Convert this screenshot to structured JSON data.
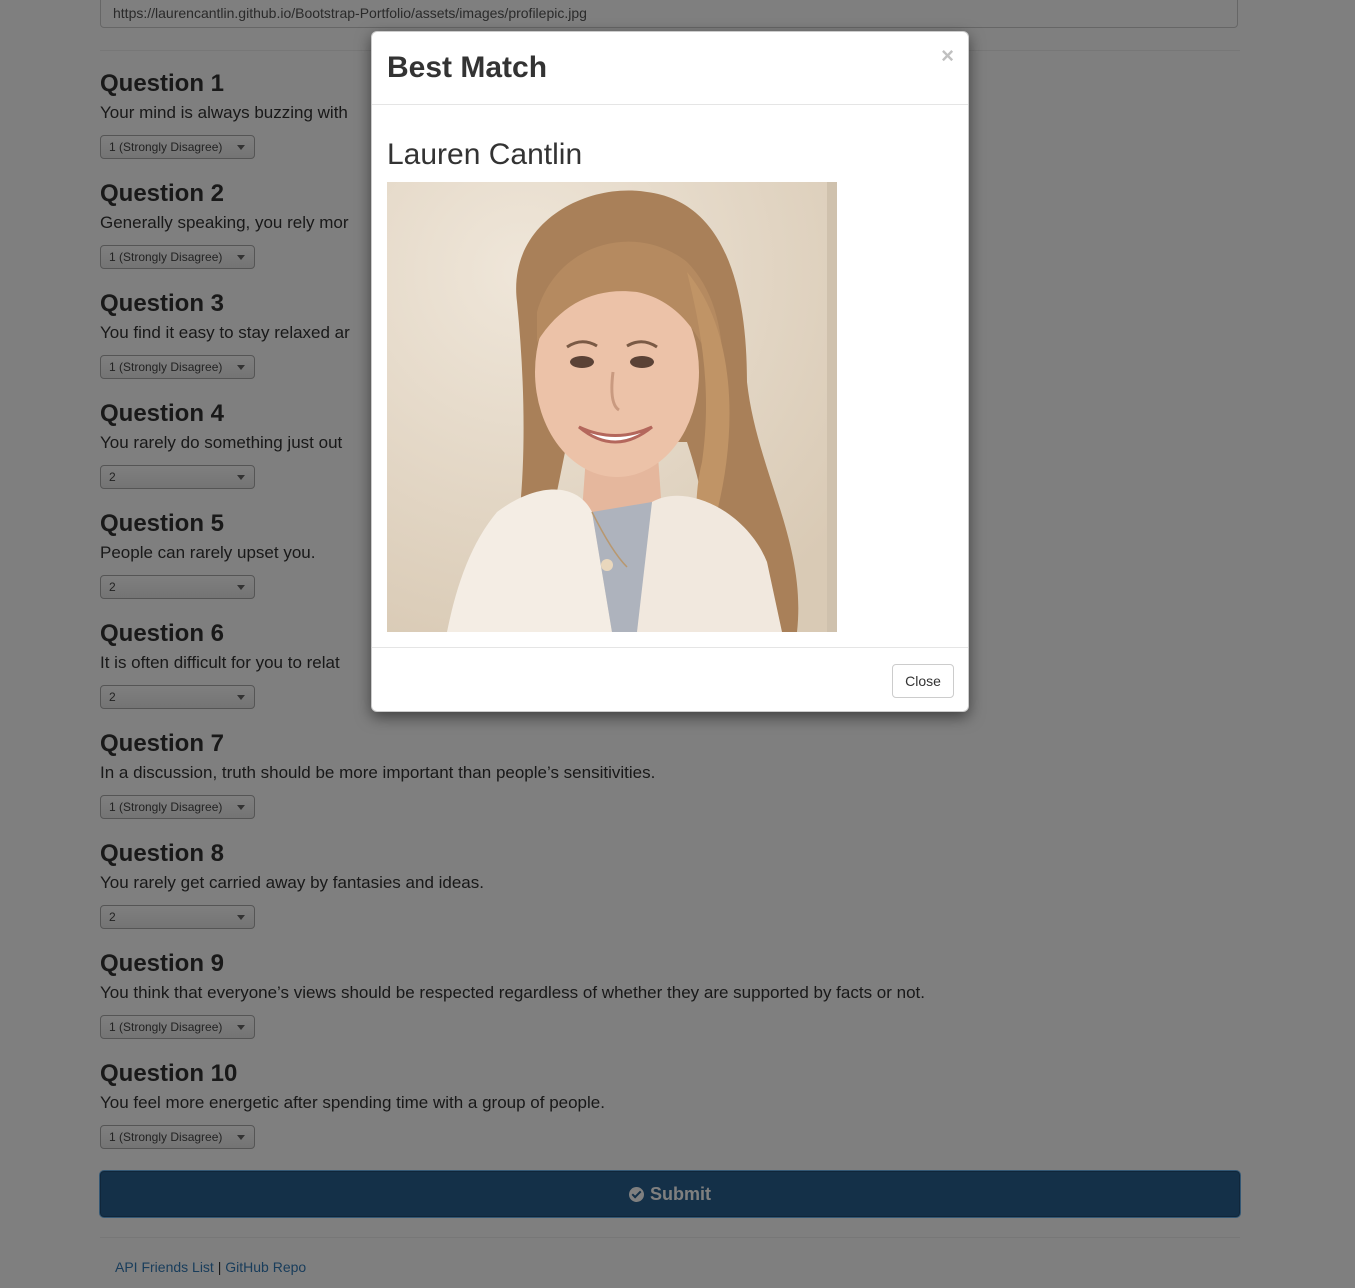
{
  "form": {
    "photo_url": "https://laurencantlin.github.io/Bootstrap-Portfolio/assets/images/profilepic.jpg",
    "questions": [
      {
        "title": "Question 1",
        "text": "Your mind is always buzzing with",
        "answer": "1 (Strongly Disagree)"
      },
      {
        "title": "Question 2",
        "text": "Generally speaking, you rely mor",
        "answer": "1 (Strongly Disagree)"
      },
      {
        "title": "Question 3",
        "text": "You find it easy to stay relaxed ar",
        "answer": "1 (Strongly Disagree)"
      },
      {
        "title": "Question 4",
        "text": "You rarely do something just out",
        "answer": "2"
      },
      {
        "title": "Question 5",
        "text": "People can rarely upset you.",
        "answer": "2"
      },
      {
        "title": "Question 6",
        "text": "It is often difficult for you to relat",
        "answer": "2"
      },
      {
        "title": "Question 7",
        "text": "In a discussion, truth should be more important than people’s sensitivities.",
        "answer": "1 (Strongly Disagree)"
      },
      {
        "title": "Question 8",
        "text": "You rarely get carried away by fantasies and ideas.",
        "answer": "2"
      },
      {
        "title": "Question 9",
        "text": "You think that everyone’s views should be respected regardless of whether they are supported by facts or not.",
        "answer": "1 (Strongly Disagree)"
      },
      {
        "title": "Question 10",
        "text": "You feel more energetic after spending time with a group of people.",
        "answer": "1 (Strongly Disagree)"
      }
    ],
    "submit_label": "Submit",
    "submit_icon": "check-circle-icon"
  },
  "footer": {
    "link1": "API Friends List",
    "separator": "|",
    "link2": "GitHub Repo"
  },
  "modal": {
    "title": "Best Match",
    "close_symbol": "×",
    "match_name": "Lauren Cantlin",
    "close_label": "Close"
  },
  "colors": {
    "primary": "#286090",
    "link": "#337ab7",
    "backdrop": "rgba(0,0,0,0.5)"
  }
}
